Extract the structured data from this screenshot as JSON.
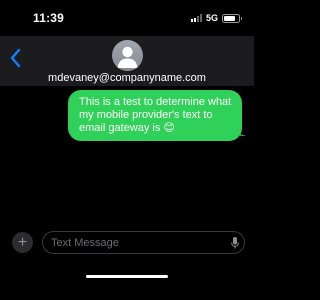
{
  "status_bar": {
    "time": "11:39",
    "network": "5G",
    "signal_bars_active": 2,
    "signal_bars_total": 4,
    "battery_level": 0.75
  },
  "header": {
    "contact": "mdevaney@companyname.com",
    "back_icon": "chevron-left-icon",
    "avatar_icon": "person-avatar-icon"
  },
  "messages": [
    {
      "direction": "outgoing",
      "text": "This is a test to determine what my mobile provider's text to email gateway is 😊",
      "color": "#30d158"
    }
  ],
  "composer": {
    "placeholder": "Text Message",
    "add_icon": "plus-icon",
    "mic_icon": "microphone-icon"
  },
  "colors": {
    "accent": "#0a84ff",
    "bubble": "#30d158",
    "header_bg": "#1c1c1e",
    "background": "#000000"
  }
}
